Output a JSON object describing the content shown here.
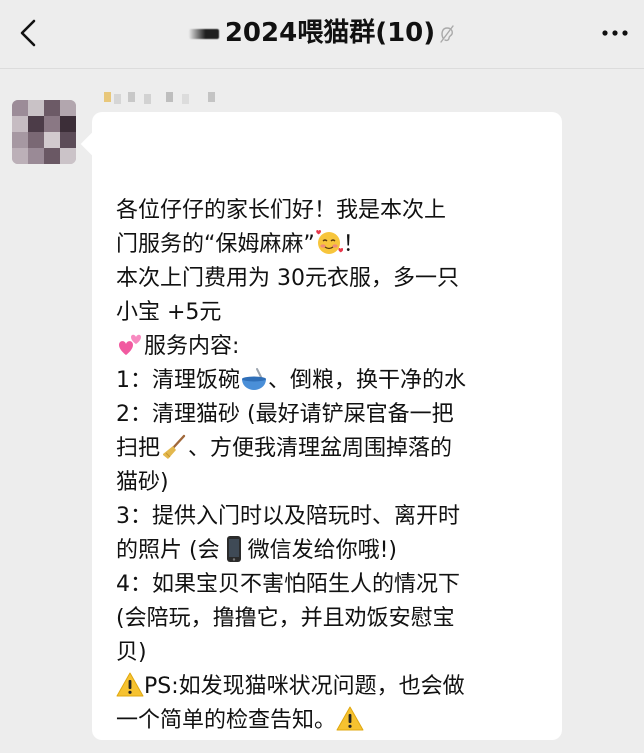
{
  "header": {
    "title": "2024喂猫群",
    "member_count": "(10)",
    "back_icon": "chevron-left-icon",
    "mute_icon": "mute-ear-icon",
    "more_icon": "more-dots-icon"
  },
  "message": {
    "lines": [
      "各位仔仔的家长们好！我是本次上",
      "门服务的“保姆麻麻”",
      "！",
      "本次上门费用为 30元衣服，多一只",
      "小宝 +5元",
      "服务内容:",
      "1：清理饭碗",
      "、倒粮，换干净的水",
      "2：清理猫砂 (最好请铲屎官备一把",
      "扫把",
      "、方便我清理盆周围掉落的",
      "猫砂)",
      "3：提供入门时以及陪玩时、离开时",
      "的照片 (会",
      "微信发给你哦!)",
      "4：如果宝贝不害怕陌生人的情况下",
      "(会陪玩，撸撸它，并且劝饭安慰宝",
      "贝)",
      "PS:如发现猫咪状况问题，也会做",
      "一个简单的检查告知。"
    ],
    "emojis": [
      "smiling-face-with-hearts",
      "two-hearts",
      "bowl-with-spoon",
      "broom",
      "mobile-phone",
      "warning-sign",
      "warning-sign"
    ]
  },
  "colors": {
    "background": "#ededed",
    "bubble": "#ffffff",
    "text": "#111111"
  }
}
